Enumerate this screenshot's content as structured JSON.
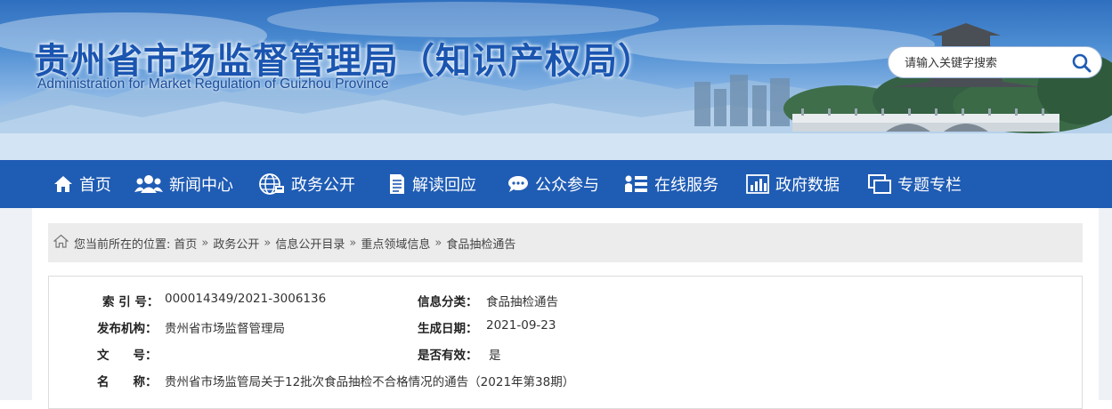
{
  "header": {
    "title": "贵州省市场监督管理局（知识产权局）",
    "subtitle": "Administration for Market Regulation of Guizhou Province",
    "search": {
      "placeholder": "请输入关键字搜索",
      "icon": "search-icon"
    }
  },
  "nav": {
    "items": [
      {
        "label": "首页",
        "icon": "home-icon"
      },
      {
        "label": "新闻中心",
        "icon": "users-icon"
      },
      {
        "label": "政务公开",
        "icon": "globe-icon"
      },
      {
        "label": "解读回应",
        "icon": "document-icon"
      },
      {
        "label": "公众参与",
        "icon": "chat-icon"
      },
      {
        "label": "在线服务",
        "icon": "service-list-icon"
      },
      {
        "label": "政府数据",
        "icon": "bar-chart-icon"
      },
      {
        "label": "专题专栏",
        "icon": "columns-icon"
      }
    ]
  },
  "breadcrumb": {
    "prefix": "您当前所在的位置:",
    "items": [
      "首页",
      "政务公开",
      "信息公开目录",
      "重点领域信息",
      "食品抽检通告"
    ],
    "separator": "»"
  },
  "info": {
    "index_label": "索 引 号：",
    "index_value": "000014349/2021-3006136",
    "category_label": "信息分类：",
    "category_value": "食品抽检通告",
    "publisher_label": "发布机构：",
    "publisher_value": "贵州省市场监督管理局",
    "date_label": "生成日期：",
    "date_value": "2021-09-23",
    "doc_no_label": "文　　号：",
    "doc_no_value": "",
    "valid_label": "是否有效：",
    "valid_value": "是",
    "name_label": "名　　称：",
    "name_value": "贵州省市场监管局关于12批次食品抽检不合格情况的通告（2021年第38期）"
  },
  "colors": {
    "nav_bg": "#1f5cb4",
    "title": "#1a55b0",
    "breadcrumb_bg": "#ececec"
  }
}
